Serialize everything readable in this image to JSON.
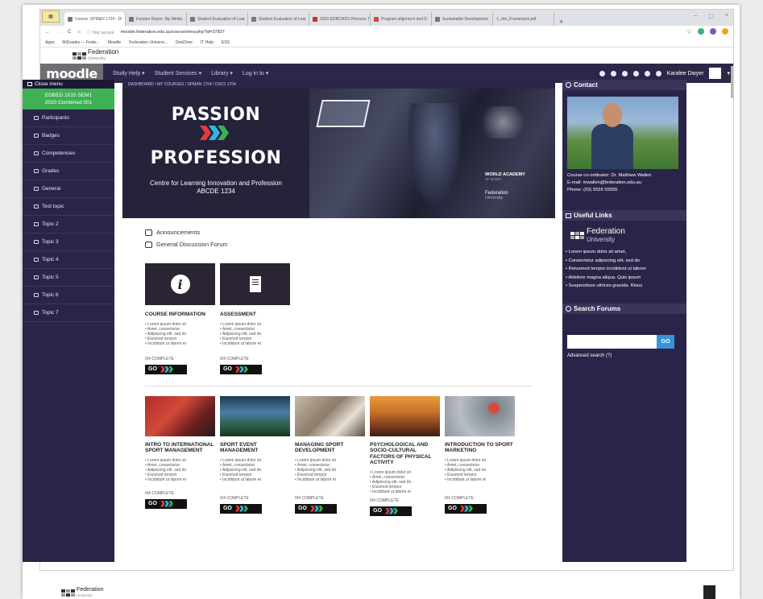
{
  "browser": {
    "tabs": [
      "Course: SPM&N 1704 - Di",
      "Karalee Dwyer: My Meldu",
      "Student Evaluation of Lear",
      "Student Evaluation of Lear",
      "2020 EDBC4001 Honours T",
      "Program alignment and D",
      "Sustainable Development",
      "1_cite_Framework.pdf"
    ],
    "new_tab": "+",
    "win_min": "–",
    "win_max": "▢",
    "win_close": "×",
    "back": "←",
    "forward": "→",
    "reload": "C",
    "home": "⌂",
    "not_secure": "ⓘ Not secure",
    "url": "moodle.federation.edu.au/course/view.php?id=37837",
    "star": "☆",
    "bookmarks": [
      "Apps",
      "MiGrades — Feder...",
      "Moodle",
      "Federation Universi...",
      "OneDrive",
      "IT Help",
      "ESS"
    ]
  },
  "federation_header": {
    "name": "Federation",
    "sub": "University"
  },
  "navbar": {
    "brand": "moodle",
    "items": [
      "Study Help ▾",
      "Student Services ▾",
      "Library ▾",
      "Log in to ▾"
    ],
    "user": "Karalee Dwyer",
    "caret": "▾"
  },
  "drawer": {
    "close_menu": "Close menu",
    "course_line1": "EDBED 1015 SEM1",
    "course_line2": "2020 Combined 001",
    "items": [
      "Participants",
      "Badges",
      "Competencies",
      "Grades",
      "General",
      "Test topic",
      "Topic 2",
      "Topic 3",
      "Topic 4",
      "Topic 5",
      "Topic 6",
      "Topic 7"
    ]
  },
  "main": {
    "breadcrumb": "DASHBOARD / MY COURSES / SPMAN 1704 / DISCI 1704",
    "banner": {
      "line1": "PASSION",
      "line2": "PROFESSION",
      "centre": "Centre for Learning Innovation and Profession",
      "code": "ABCDE 1234",
      "world_academy": "WORLD ACADEMY",
      "world_academy_sub": "OF SPORT",
      "fed": "Federation",
      "fed_sub": "University"
    },
    "links": [
      "Announcements",
      "General Discussion Forum"
    ],
    "info_glyph": "i",
    "top_cards": [
      {
        "title": "COURSE INFORMATION",
        "bullets": "• Lorem ipsum dolor sit\n• Amet, consectetur\n• Adipiscing elit, sed do\n• Eiusmod tempor\n• Incididunt ut labore et",
        "complete": "0/4 COMPLETE",
        "go": "GO"
      },
      {
        "title": "ASSESSMENT",
        "bullets": "• Lorem ipsum dolor sit\n• Amet, consectetur\n• Adipiscing elit, sed do\n• Eiusmod tempor\n• Incididunt ut labore et",
        "complete": "0/4 COMPLETE",
        "go": "GO"
      }
    ],
    "bottom_cards": [
      {
        "title": "INTRO TO INTERNATIONAL SPORT MANAGEMENT",
        "bullets": "• Lorem ipsum dolor sit\n• Amet, consectetur\n• Adipiscing elit, sed do\n• Eiusmod tempor\n• Incididunt ut labore et",
        "complete": "0/4 COMPLETE",
        "go": "GO"
      },
      {
        "title": "SPORT EVENT MANAGEMENT",
        "bullets": "• Lorem ipsum dolor sit\n• Amet, consectetur\n• Adipiscing elit, sed do\n• Eiusmod tempor\n• Incididunt ut labore et",
        "complete": "0/4 COMPLETE",
        "go": "GO"
      },
      {
        "title": "MANAGING SPORT DEVELOPMENT",
        "bullets": "• Lorem ipsum dolor sit\n• Amet, consectetur\n• Adipiscing elit, sed do\n• Eiusmod tempor\n• Incididunt ut labore et",
        "complete": "0/4 COMPLETE",
        "go": "GO"
      },
      {
        "title": "PSYCHOLOGICAL AND SOCIO-CULTURAL FACTORS OF PHYSICAL ACTIVITY",
        "bullets": "• Lorem ipsum dolor sit\n• Amet, consectetur\n• Adipiscing elit, sed do\n• Eiusmod tempor\n• Incididunt ut labore et",
        "complete": "0/4 COMPLETE",
        "go": "GO"
      },
      {
        "title": "INTRODUCTION TO SPORT MARKETING",
        "bullets": "• Lorem ipsum dolor sit\n• Amet, consectetur\n• Adipiscing elit, sed do\n• Eiusmod tempor\n• Incididunt ut labore et",
        "complete": "0/4 COMPLETE",
        "go": "GO"
      }
    ]
  },
  "right": {
    "contact_title": "Contact",
    "coordinator": "Course co-ordinator: Dr. Matthew Wallen",
    "email": "E-mail: mwallen@federation.edu.au",
    "phone": "Phone: (03) 5555 55555",
    "links_title": "Useful Links",
    "fed": "Federation",
    "fed_sub": "University",
    "bullets": [
      "Lorem ipsum dolor sit amet,",
      "Consectetur adipiscing elit, sed do",
      "Reiusmod tempor incididunt ut labore",
      "Aldolore magna aliqua. Quis ipsum",
      "Suspendisse ultrices gravida. Risus"
    ],
    "search_title": "Search Forums",
    "search_go": "GO",
    "advanced": "Advanced search (?)"
  },
  "footer": {
    "fed": "Federation",
    "fed_sub": "University"
  },
  "colors": {
    "navbar": "#2c2749",
    "drawer": "#2a2548",
    "active_course": "#3db153",
    "chevrons": [
      "#e23b3b",
      "#2fb6e6",
      "#3db153"
    ],
    "go_button": "#3a92d6"
  }
}
